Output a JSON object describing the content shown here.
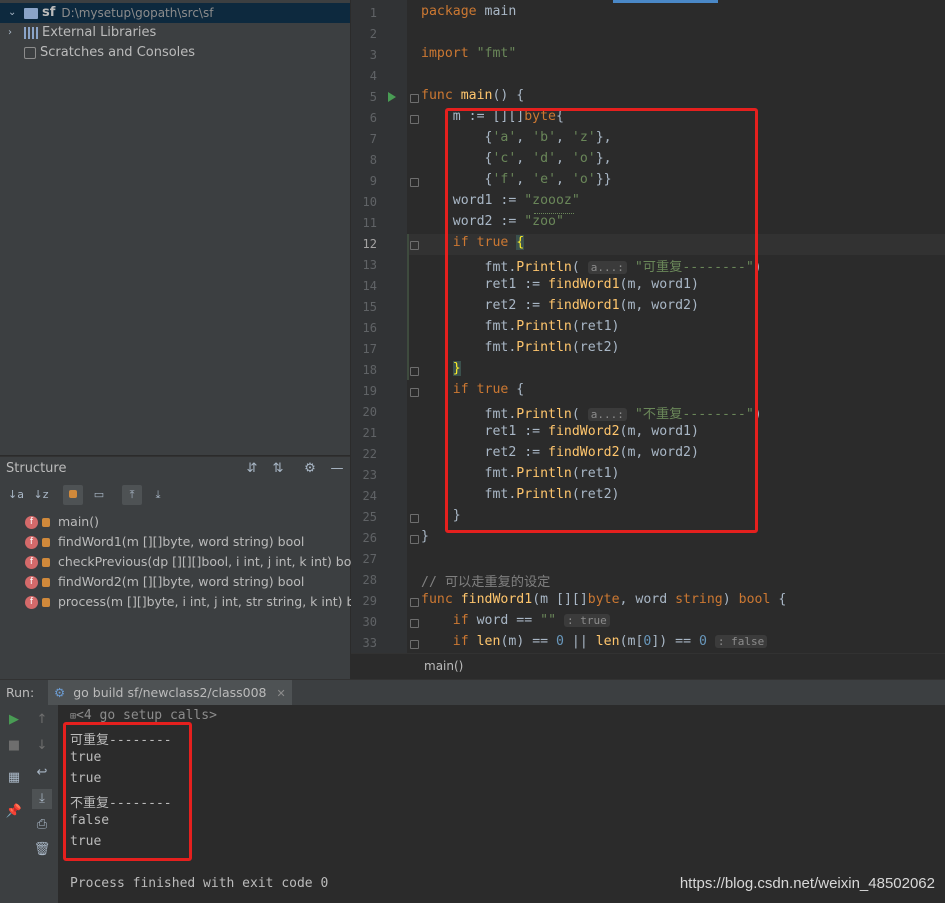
{
  "project": {
    "root_name": "sf",
    "root_path": "D:\\mysetup\\gopath\\src\\sf",
    "external_libraries": "External Libraries",
    "scratches": "Scratches and Consoles"
  },
  "structure": {
    "title": "Structure",
    "items": [
      {
        "icon": "f",
        "label": "main()"
      },
      {
        "icon": "f",
        "label": "findWord1(m [][]byte, word string) bool"
      },
      {
        "icon": "f",
        "label": "checkPrevious(dp [][][]bool, i int, j int, k int) bool"
      },
      {
        "icon": "f",
        "label": "findWord2(m [][]byte, word string) bool"
      },
      {
        "icon": "f",
        "label": "process(m [][]byte, i int, j int, str string, k int) bool"
      }
    ]
  },
  "editor": {
    "line_numbers": [
      "1",
      "2",
      "3",
      "4",
      "5",
      "6",
      "7",
      "8",
      "9",
      "10",
      "11",
      "12",
      "13",
      "14",
      "15",
      "16",
      "17",
      "18",
      "19",
      "20",
      "21",
      "22",
      "23",
      "24",
      "25",
      "26",
      "27",
      "28",
      "29",
      "30",
      "33"
    ],
    "breadcrumb": "main()",
    "hint_a": "a...:",
    "hint_true": ": true",
    "hint_false": ": false"
  },
  "run": {
    "label": "Run:",
    "tab": "go build sf/newclass2/class008",
    "setup_calls": "<4 go setup calls>",
    "output": [
      "可重复--------",
      "true",
      "true",
      "不重复--------",
      "false",
      "true"
    ],
    "finish": "Process finished with exit code 0",
    "watermark": "https://blog.csdn.net/weixin_48502062"
  },
  "colors": {
    "highlight_box": "#e5201e",
    "keyword": "#cc7832",
    "string": "#6a8759",
    "function": "#ffc66d"
  }
}
